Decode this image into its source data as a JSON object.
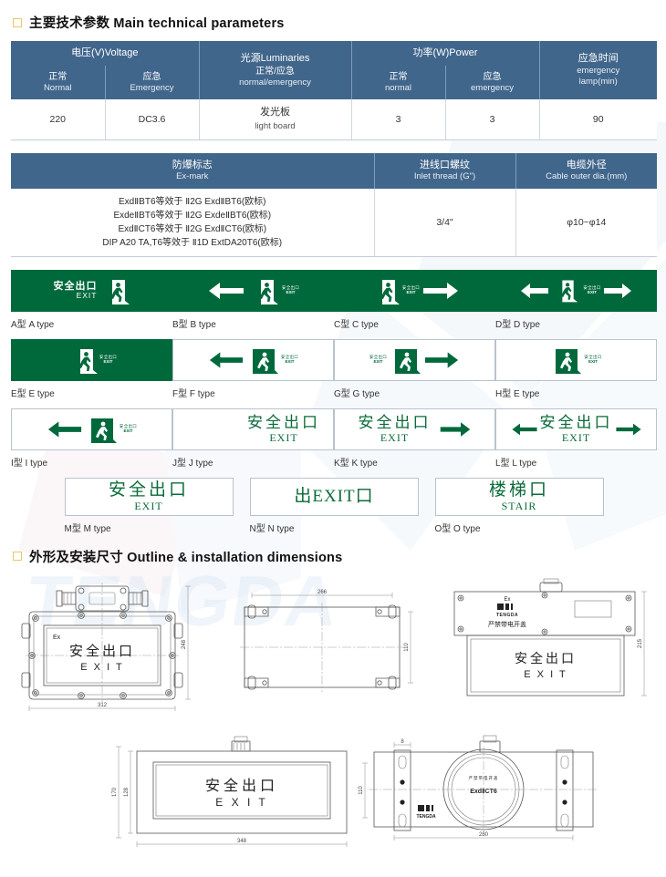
{
  "sections": {
    "params_title": "主要技术参数 Main technical parameters",
    "outline_title": "外形及安装尺寸  Outline & installation dimensions"
  },
  "table1": {
    "headers": [
      {
        "group_cn": "电压(V)",
        "group_en": "Voltage",
        "sub_cn": "正常",
        "sub_en": "Normal"
      },
      {
        "group_cn": "",
        "group_en": "",
        "sub_cn": "应急",
        "sub_en": "Emergency"
      },
      {
        "group_cn": "光源",
        "group_en": "Luminaries",
        "sub_cn": "正常/应急",
        "sub_en": "normal/emergency"
      },
      {
        "group_cn": "功率(W)",
        "group_en": "Power",
        "sub_cn": "正常",
        "sub_en": "normal"
      },
      {
        "group_cn": "",
        "group_en": "",
        "sub_cn": "应急",
        "sub_en": "emergency"
      },
      {
        "group_cn": "应急时间",
        "group_en": "",
        "sub_cn": "emergency",
        "sub_en": "lamp(min)"
      }
    ],
    "header_voltage_cn": "电压(V)",
    "header_voltage_en": "Voltage",
    "header_normal_cn": "正常",
    "header_normal_en": "Normal",
    "header_emergency_cn": "应急",
    "header_emergency_en": "Emergency",
    "header_light_cn": "光源",
    "header_light_en": "Luminaries",
    "header_light_sub_cn": "正常/应急",
    "header_light_sub_en": "normal/emergency",
    "header_power_cn": "功率(W)",
    "header_power_en": "Power",
    "header_power_normal_cn": "正常",
    "header_power_normal_en": "normal",
    "header_power_emg_cn": "应急",
    "header_power_emg_en": "emergency",
    "header_time_cn": "应急时间",
    "header_time_en1": "emergency",
    "header_time_en2": "lamp(min)",
    "row": {
      "voltage_normal": "220",
      "voltage_emergency": "DC3.6",
      "light_cn": "发光板",
      "light_en": "light board",
      "power_normal": "3",
      "power_emergency": "3",
      "emergency_time": "90"
    }
  },
  "table2": {
    "header_exmark_cn": "防爆标志",
    "header_exmark_en": "Ex-mark",
    "header_inlet_cn": "进线口螺纹",
    "header_inlet_en": "Inlet thread (G\")",
    "header_cable_cn": "电缆外径",
    "header_cable_en": "Cable outer dia.(mm)",
    "ex_marks": [
      "ExdⅡBT6等效于 Ⅱ2G ExdⅡBT6(欧标)",
      "ExdeⅡBT6等效于 Ⅱ2G ExdeⅡBT6(欧标)",
      "ExdⅡCT6等效于 Ⅱ2G ExdⅡCT6(欧标)",
      "DIP A20 TA,T6等效于 Ⅱ1D ExtDA20T6(欧标)"
    ],
    "inlet_thread": "3/4\"",
    "cable_dia": "φ10~φ14"
  },
  "signs": {
    "exit_cn": "安全出口",
    "exit_en": "EXIT",
    "mini_cn": "安全出口",
    "mini_en": "EXIT",
    "items": [
      {
        "id": "A",
        "label": "A型 A type",
        "bg": "green",
        "layout": "text-left-man-right"
      },
      {
        "id": "B",
        "label": "B型 B type",
        "bg": "green",
        "layout": "arrow-left-man"
      },
      {
        "id": "C",
        "label": "C型 C type",
        "bg": "green",
        "layout": "man-arrow-right"
      },
      {
        "id": "D",
        "label": "D型 D type",
        "bg": "green",
        "layout": "arrow-left-man-arrow-right"
      },
      {
        "id": "E",
        "label": "E型 E type",
        "bg": "green",
        "layout": "man-center"
      },
      {
        "id": "F",
        "label": "F型 F type",
        "bg": "white",
        "layout": "arrow-left-man"
      },
      {
        "id": "G",
        "label": "G型 G type",
        "bg": "white",
        "layout": "man-arrow-right"
      },
      {
        "id": "H",
        "label": "H型 E type",
        "bg": "white",
        "layout": "man-center"
      },
      {
        "id": "I",
        "label": "I型 I type",
        "bg": "white",
        "layout": "arrow-left-man"
      },
      {
        "id": "J",
        "label": "J型 J type",
        "bg": "white",
        "layout": "text-right"
      },
      {
        "id": "K",
        "label": "K型 K type",
        "bg": "white",
        "layout": "text-arrow-right"
      },
      {
        "id": "L",
        "label": "L型 L type",
        "bg": "white",
        "layout": "arrow-left-text-arrow-right"
      },
      {
        "id": "M",
        "label": "M型 M type",
        "bg": "white",
        "layout": "text-only",
        "text_cn": "安全出口",
        "text_en": "EXIT"
      },
      {
        "id": "N",
        "label": "N型 N type",
        "bg": "white",
        "layout": "text-only-inline",
        "text_cn": "出EXIT口",
        "text_en": ""
      },
      {
        "id": "O",
        "label": "O型 O type",
        "bg": "white",
        "layout": "text-only",
        "text_cn": "楼梯口",
        "text_en": "STAIR"
      }
    ]
  },
  "drawings": {
    "front": {
      "ex_label": "Ex",
      "text_cn": "安全出口",
      "text_en": "E X I T",
      "dim_width": "312",
      "dim_height": "248"
    },
    "top": {
      "dim_width": "266",
      "dim_height": "110"
    },
    "side": {
      "ex_label": "Ex",
      "brand": "TENGDA",
      "warning_cn": "严禁带电开盖",
      "text_cn": "安全出口",
      "text_en": "E X I T",
      "dim_height": "215"
    },
    "bottom_left": {
      "text_cn": "安全出口",
      "text_en": "E X I T",
      "dim_height_outer": "170",
      "dim_height_inner": "128",
      "dim_width": "348"
    },
    "bottom_right": {
      "brand": "TENGDA",
      "circle_mark": "ExdⅡCT6",
      "circle_top_cn": "严禁带电开盖",
      "dim_width": "280",
      "dim_height": "110",
      "dim_small": "8"
    }
  },
  "colors": {
    "header_blue": "#41668c",
    "sign_green": "#00693c",
    "text_green": "#0b6b3a",
    "accent_square": "#e8c66a"
  }
}
